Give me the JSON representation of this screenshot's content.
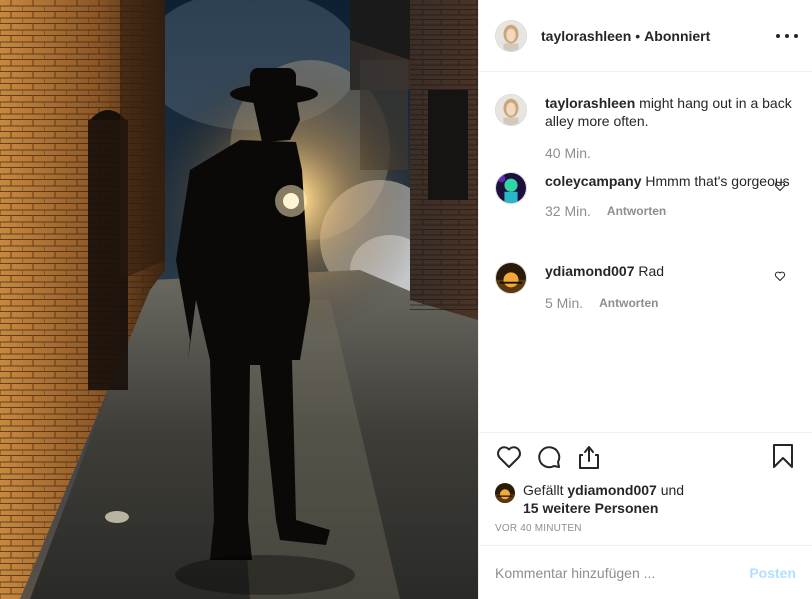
{
  "post": {
    "author": "taylorashleen",
    "separator": "•",
    "follow_state": "Abonniert",
    "caption_username": "taylorashleen",
    "caption_text": "might hang out in a back alley more often.",
    "caption_time": "40 Min."
  },
  "comments": [
    {
      "username": "coleycampany",
      "text": "Hmmm that's gorgeous",
      "time": "32 Min.",
      "reply_label": "Antworten"
    },
    {
      "username": "ydiamond007",
      "text": "Rad",
      "time": "5 Min.",
      "reply_label": "Antworten"
    }
  ],
  "likes": {
    "prefix": "Gefällt",
    "liker": "ydiamond007",
    "conjunction": "und",
    "others": "15 weitere Personen"
  },
  "timestamp": "VOR 40 MINUTEN",
  "comment_box": {
    "placeholder": "Kommentar hinzufügen ...",
    "post_label": "Posten"
  },
  "icons": {
    "more": "more-options-icon",
    "like": "heart-icon",
    "comment": "comment-icon",
    "share": "share-icon",
    "save": "bookmark-icon"
  },
  "colors": {
    "text": "#262626",
    "muted": "#8e8e8e",
    "border": "#efefef",
    "post_button_disabled": "#b2dffc"
  }
}
